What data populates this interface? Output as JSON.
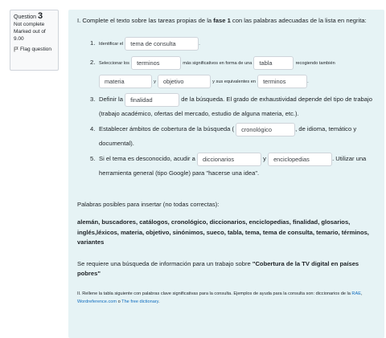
{
  "question_info": {
    "label": "Question",
    "number": "3",
    "status": "Not complete",
    "marked_out_of": "Marked out of 9.00",
    "flag_label": "Flag question"
  },
  "intro": {
    "before": "I. Complete el texto sobre las tareas propias de la ",
    "bold": "fase 1",
    "after": " con las palabras adecuadas de la lista en negrita:"
  },
  "items": {
    "i1": {
      "num": "1.",
      "t1": "Identificar el",
      "a1": "tema de consulta",
      "t2": "."
    },
    "i2": {
      "num": "2.",
      "t1": "Seleccionar los",
      "a1": "terminos",
      "t2": "más significativos en forma de una",
      "a2": "tabla",
      "t3": "recogiendo también",
      "a3": "materia",
      "t4": "y",
      "a4": "objetivo",
      "t5": "y sus equivalentes en",
      "a5": "terminos",
      "t6": "."
    },
    "i3": {
      "num": "3.",
      "t1": "Definir la",
      "a1": "finalidad",
      "t2": "de la búsqueda.  El grado de exhaustividad depende del tipo de trabajo (trabajo académico, ofertas del mercado, estudio de alguna materia, etc.)."
    },
    "i4": {
      "num": "4.",
      "t1": "Establecer ámbitos de cobertura de la búsqueda (",
      "a1": "cronológico",
      "t2": ", de idioma, temático y documental)."
    },
    "i5": {
      "num": "5.",
      "t1": "Si el tema es desconocido, acudir a",
      "a1": "diccionarios",
      "t2": "y",
      "a2": "enciclopedias",
      "t3": ". Utilizar una herramienta general (tipo Google) para \"hacerse una idea\"."
    }
  },
  "words_intro": "Palabras posibles para insertar (no todas correctas):",
  "words_list": "alemán, buscadores, catálogos, cronológico, diccionarios, enciclopedias, finalidad, glosarios, inglés,léxicos, materia, objetivo, sinónimos, sueco, tabla, tema, tema de consulta, temario, términos, variantes",
  "search": {
    "before": "Se requiere una búsqueda de información para un trabajo sobre ",
    "bold": "\"Cobertura de la TV digital en países pobres\""
  },
  "footer": {
    "text": "II. Rellene la tabla siguiente con palabras clave significativas para la consulta. Ejemplos de ayuda para la consulta son: diccionarios de  la ",
    "link1": "RAE",
    "sep1": ", ",
    "link2": "Wordreference.com",
    "sep2": " o ",
    "link3": "The free dictionary",
    "end": "."
  },
  "colors": {
    "content_bg": "#e6f3f5",
    "info_bg": "#f8f9fa",
    "link": "#0f6cbf"
  }
}
